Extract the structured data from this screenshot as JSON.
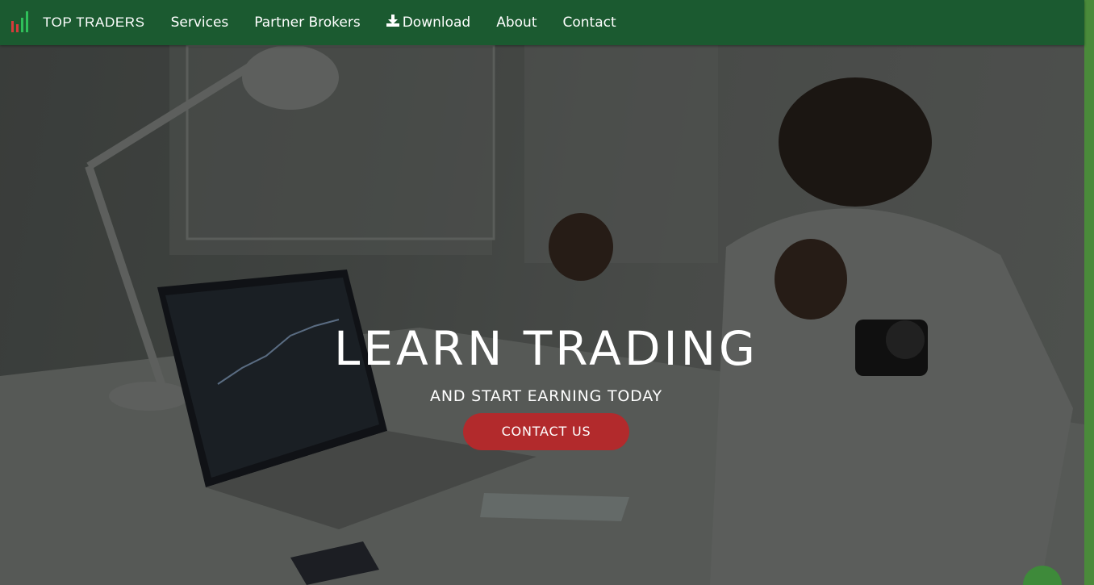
{
  "colors": {
    "navbar": "#1b5a30",
    "cta": "#b22a2c",
    "logo_red": "#d63b3b",
    "logo_green": "#2fbf5a",
    "scrollbar": "#4a8a3a"
  },
  "brand": {
    "name": "TOP TRADERS",
    "logo_icon": "candlestick-chart-icon"
  },
  "nav": {
    "items": [
      {
        "label": "Services"
      },
      {
        "label": "Partner Brokers"
      },
      {
        "label": "Download",
        "icon": "download-icon"
      },
      {
        "label": "About"
      },
      {
        "label": "Contact"
      }
    ]
  },
  "hero": {
    "title": "LEARN TRADING",
    "subtitle": "AND START EARNING TODAY",
    "cta_label": "CONTACT US"
  }
}
